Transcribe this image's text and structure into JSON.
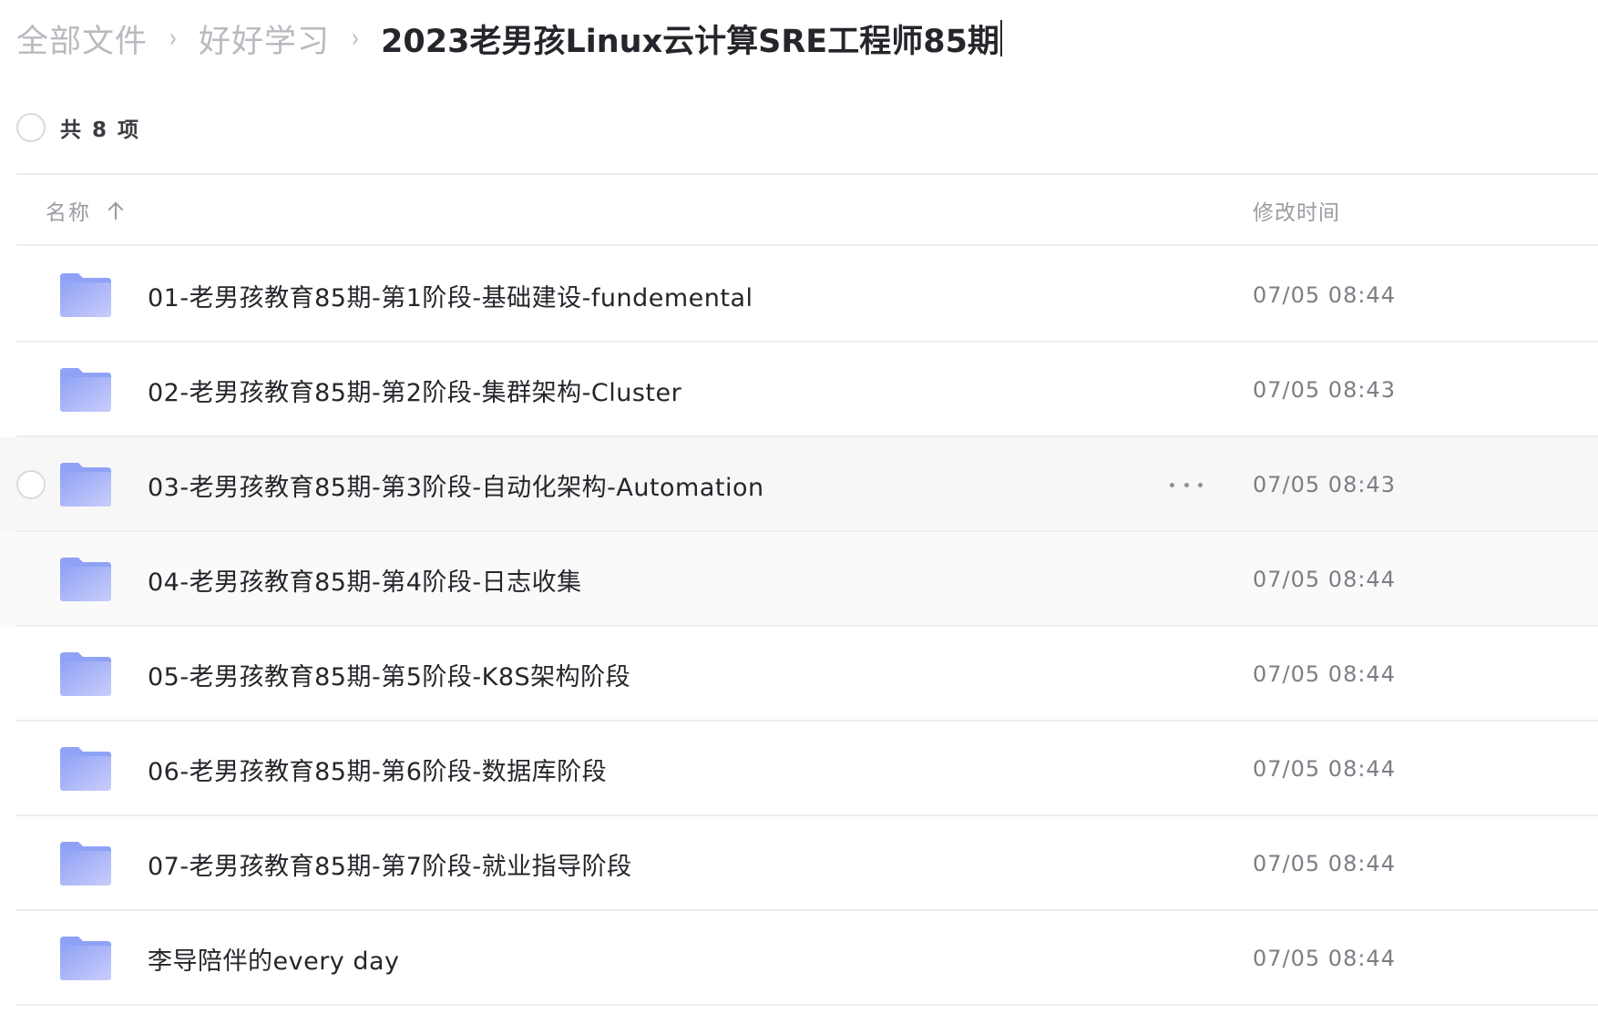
{
  "breadcrumb": {
    "items": [
      "全部文件",
      "好好学习"
    ],
    "separator": "›",
    "current": "2023老男孩Linux云计算SRE工程师85期"
  },
  "toolbar": {
    "count_text": "共 8 项"
  },
  "table": {
    "columns": {
      "name": "名称",
      "modified": "修改时间"
    },
    "sort": "name-ascending",
    "rows": [
      {
        "name": "01-老男孩教育85期-第1阶段-基础建设-fundemental",
        "time": "07/05 08:44",
        "icon": "folder-icon"
      },
      {
        "name": "02-老男孩教育85期-第2阶段-集群架构-Cluster",
        "time": "07/05 08:43",
        "icon": "folder-icon"
      },
      {
        "name": "03-老男孩教育85期-第3阶段-自动化架构-Automation",
        "time": "07/05 08:43",
        "icon": "folder-icon",
        "hovered": true
      },
      {
        "name": "04-老男孩教育85期-第4阶段-日志收集",
        "time": "07/05 08:44",
        "icon": "folder-icon"
      },
      {
        "name": "05-老男孩教育85期-第5阶段-K8S架构阶段",
        "time": "07/05 08:44",
        "icon": "folder-icon"
      },
      {
        "name": "06-老男孩教育85期-第6阶段-数据库阶段",
        "time": "07/05 08:44",
        "icon": "folder-icon"
      },
      {
        "name": "07-老男孩教育85期-第7阶段-就业指导阶段",
        "time": "07/05 08:44",
        "icon": "folder-icon"
      },
      {
        "name": "李导陪伴的every day",
        "time": "07/05 08:44",
        "icon": "folder-icon"
      }
    ]
  },
  "colors": {
    "folder_top": "#8fa2f5",
    "folder_bottom": "#c9cdfa",
    "text": "#25262b",
    "muted": "#9b9ca3",
    "divider": "#ededf0",
    "hover_bg": "#f7f7f8"
  }
}
